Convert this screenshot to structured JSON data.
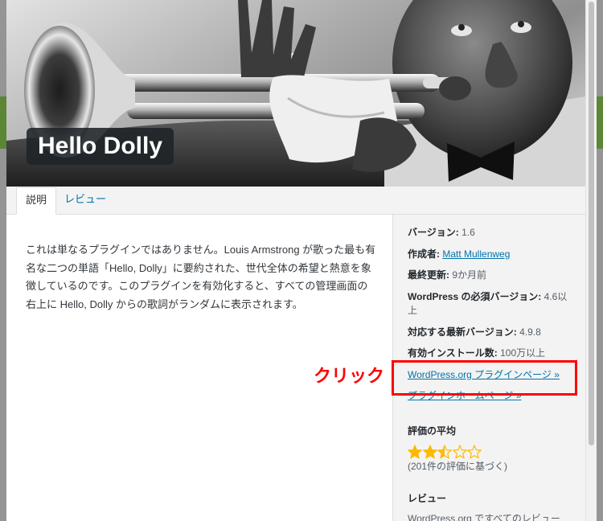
{
  "modal": {
    "banner": {
      "title": "Hello Dolly"
    },
    "tabs": [
      {
        "label": "説明",
        "active": true
      },
      {
        "label": "レビュー",
        "active": false
      }
    ],
    "description": "これは単なるプラグインではありません。Louis Armstrong が歌った最も有名な二つの単語「Hello, Dolly」に要約された、世代全体の希望と熱意を象徴しているのです。このプラグインを有効化すると、すべての管理画面の右上に Hello, Dolly からの歌詞がランダムに表示されます。",
    "sidebar": {
      "version": {
        "label": "バージョン:",
        "value": "1.6"
      },
      "author": {
        "label": "作成者:",
        "value": "Matt Mullenweg"
      },
      "last_updated": {
        "label": "最終更新:",
        "value": "9か月前"
      },
      "requires": {
        "label": "WordPress の必須バージョン:",
        "value": "4.6以上"
      },
      "tested": {
        "label": "対応する最新バージョン:",
        "value": "4.9.8"
      },
      "installs": {
        "label": "有効インストール数:",
        "value": "100万以上"
      },
      "plugin_page_link": "WordPress.org プラグインページ »",
      "homepage_link": "プラグインホームページ »",
      "rating": {
        "heading": "評価の平均",
        "value": 2.5,
        "max": 5,
        "count_text": "(201件の評価に基づく)"
      },
      "reviews": {
        "heading": "レビュー",
        "text": "WordPress.org ですべてのレビュー"
      }
    }
  },
  "annotation": {
    "text": "クリック"
  },
  "colors": {
    "link": "#0073aa",
    "annotation": "#ff0000",
    "star": "#ffb900",
    "sidebar_background": "#f3f3f3",
    "title_background": "#1d2327"
  }
}
